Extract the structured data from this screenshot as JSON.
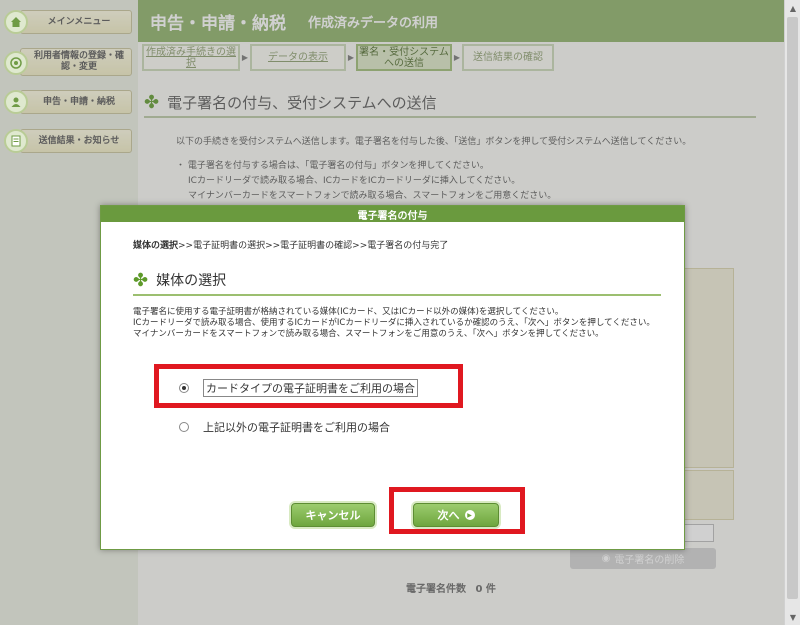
{
  "sidebar": {
    "items": [
      {
        "label": "メインメニュー"
      },
      {
        "label": "利用者情報の登録・確認・変更"
      },
      {
        "label": "申告・申請・納税"
      },
      {
        "label": "送信結果・お知らせ"
      }
    ]
  },
  "header": {
    "title": "申告・申請・納税",
    "subtitle": "作成済みデータの利用"
  },
  "steps": [
    {
      "label": "作成済み手続きの選択"
    },
    {
      "label": "データの表示"
    },
    {
      "label": "署名・受付システムへの送信"
    },
    {
      "label": "送信結果の確認"
    }
  ],
  "page": {
    "title": "電子署名の付与、受付システムへの送信",
    "intro": "以下の手続きを受付システムへ送信します。電子署名を付与した後、「送信」ボタンを押して受付システムへ送信してください。",
    "notes": [
      "・ 電子署名を付与する場合は、「電子署名の付与」ボタンを押してください。",
      "ICカードリーダで読み取る場合、ICカードをICカードリーダに挿入してください。",
      "マイナンバーカードをスマートフォンで読み取る場合、スマートフォンをご用意ください。"
    ],
    "sign_button": "電子署名の削除",
    "count_label": "電子署名件数",
    "count_value": "0 件"
  },
  "modal": {
    "title": "電子署名の付与",
    "crumb_current": "媒体の選択",
    "crumb_rest": ">>電子証明書の選択>>電子証明書の確認>>電子署名の付与完了",
    "heading": "媒体の選択",
    "desc_lines": [
      "電子署名に使用する電子証明書が格納されている媒体(ICカード、又はICカード以外の媒体)を選択してください。",
      "ICカードリーダで読み取る場合、使用するICカードがICカードリーダに挿入されているか確認のうえ、「次へ」ボタンを押してください。",
      "マイナンバーカードをスマートフォンで読み取る場合、スマートフォンをご用意のうえ、「次へ」ボタンを押してください。"
    ],
    "option_card": "カードタイプの電子証明書をご利用の場合",
    "option_other": "上記以外の電子証明書をご利用の場合",
    "selected_option": "card",
    "cancel_label": "キャンセル",
    "next_label": "次へ"
  },
  "colors": {
    "header_green": "#8db166",
    "modal_green": "#6a9a3e",
    "highlight_red": "#e01820"
  }
}
